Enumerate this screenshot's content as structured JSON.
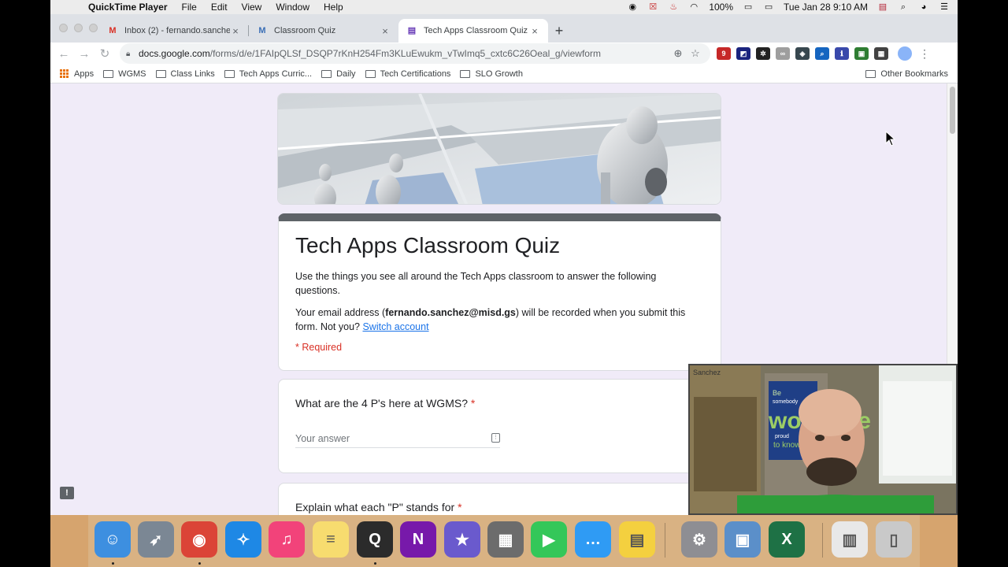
{
  "menubar": {
    "app_name": "QuickTime Player",
    "menus": [
      "File",
      "Edit",
      "View",
      "Window",
      "Help"
    ],
    "battery": "100%",
    "datetime": "Tue Jan 28  9:10 AM"
  },
  "tabs": [
    {
      "label": "Inbox (2) - fernando.sanchez@",
      "favicon": "gmail-icon",
      "color": "#d93025",
      "glyph": "M"
    },
    {
      "label": "Classroom Quiz",
      "favicon": "microsoft-forms-icon",
      "color": "#3b6fb6",
      "glyph": "M"
    },
    {
      "label": "Tech Apps Classroom Quiz",
      "favicon": "google-forms-icon",
      "color": "#673ab7",
      "glyph": "▤"
    }
  ],
  "address_bar": {
    "host": "docs.google.com",
    "path": "/forms/d/e/1FAIpQLSf_DSQP7rKnH254Fm3KLuEwukm_vTwImq5_cxtc6C26Oeal_g/viewform"
  },
  "bookmarks": {
    "apps_label": "Apps",
    "folders": [
      "WGMS",
      "Class Links",
      "Tech Apps Curric...",
      "Daily",
      "Tech Certifications",
      "SLO Growth"
    ],
    "other": "Other Bookmarks"
  },
  "form": {
    "title": "Tech Apps Classroom Quiz",
    "description": "Use the things you see all around the Tech Apps classroom to answer the following questions.",
    "email_prefix": "Your email address (",
    "email": "fernando.sanchez@misd.gs",
    "email_suffix": ") will be recorded when you submit this form. Not you?",
    "switch_account": "Switch account",
    "required_note": "* Required",
    "questions": [
      {
        "title": "What are the 4 P's here at WGMS?",
        "required_mark": "*",
        "placeholder": "Your answer"
      },
      {
        "title": "Explain what each \"P\" stands for",
        "required_mark": "*"
      }
    ]
  },
  "webcam": {
    "poster_text_1": "Be",
    "poster_text_2": "somebody",
    "poster_big": "YOU",
    "poster_text_3": "would be",
    "poster_text_4": "proud",
    "poster_text_5": "to know.",
    "nameplate": "Sanchez"
  },
  "dock": {
    "apps": [
      {
        "name": "finder-icon",
        "color": "#3d8fe0"
      },
      {
        "name": "launchpad-icon",
        "color": "#7b8794"
      },
      {
        "name": "chrome-icon",
        "color": "#db4437"
      },
      {
        "name": "safari-icon",
        "color": "#1e88e5"
      },
      {
        "name": "itunes-icon",
        "color": "#f2437a"
      },
      {
        "name": "notes-icon",
        "color": "#f7dc6f"
      },
      {
        "name": "quicktime-icon",
        "color": "#2b2b2b"
      },
      {
        "name": "onenote-icon",
        "color": "#7719aa"
      },
      {
        "name": "imovie-icon",
        "color": "#6a5acd"
      },
      {
        "name": "calculator-icon",
        "color": "#6c6c6c"
      },
      {
        "name": "facetime-icon",
        "color": "#34c759"
      },
      {
        "name": "messages-icon",
        "color": "#2f9bf4"
      },
      {
        "name": "stickies-icon",
        "color": "#f4d03f"
      },
      {
        "name": "system-preferences-icon",
        "color": "#8e8e93"
      },
      {
        "name": "preview-icon",
        "color": "#5b8fc9"
      },
      {
        "name": "excel-icon",
        "color": "#1e7145"
      },
      {
        "name": "chrome-apps-icon",
        "color": "#e8e8e8"
      },
      {
        "name": "trash-icon",
        "color": "#c9c9c9"
      }
    ]
  }
}
